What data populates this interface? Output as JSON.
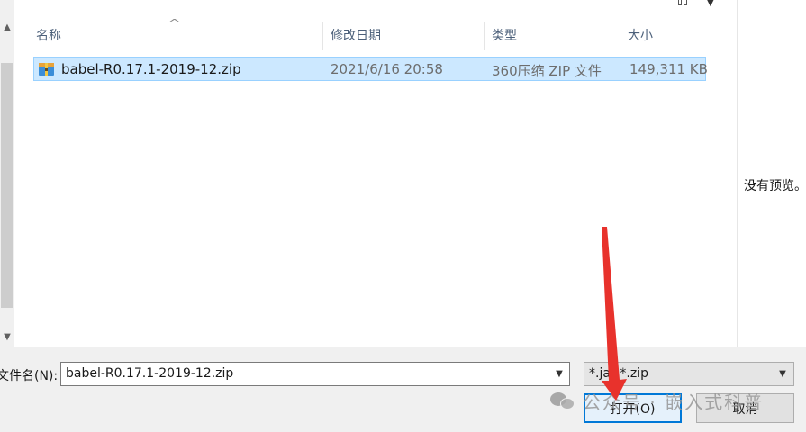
{
  "columns": {
    "name": "名称",
    "date": "修改日期",
    "type": "类型",
    "size": "大小"
  },
  "file": {
    "name": "babel-R0.17.1-2019-12.zip",
    "date": "2021/6/16 20:58",
    "type": "360压缩 ZIP 文件",
    "size": "149,311 KB"
  },
  "preview": {
    "empty_text": "没有预览。"
  },
  "bottom": {
    "filename_label": "文件名(N):",
    "filename_value": "babel-R0.17.1-2019-12.zip",
    "filter_value": "*.jar;*.zip",
    "open_label": "打开(O)",
    "cancel_label": "取消"
  },
  "watermark": {
    "text": "公众号 · 嵌入式科普"
  },
  "colors": {
    "selection": "#cce8ff",
    "accent": "#0078d7",
    "annotation_arrow": "#e8322c"
  },
  "icons": {
    "file": "zip-archive-icon",
    "view": "view-options-icon",
    "pane": "preview-pane-icon",
    "help": "help-icon",
    "watermark": "wechat-icon"
  }
}
